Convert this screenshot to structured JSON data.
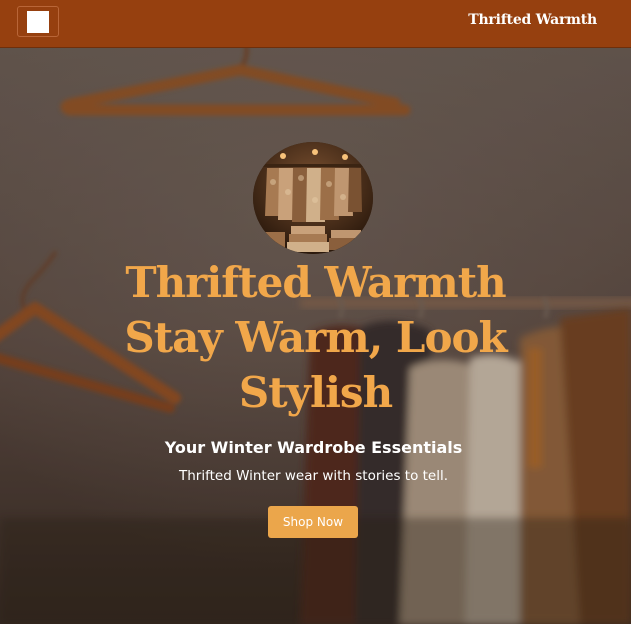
{
  "navbar": {
    "menu_icon": "square-icon",
    "brand": "Thrifted Warmth",
    "background": "#96400f"
  },
  "hero": {
    "title_line1": "Thrifted Warmth",
    "title_line2": "Stay Warm, Look",
    "title_line3": "Stylish",
    "subtitle": "Your Winter Wardrobe Essentials",
    "tagline": "Thrifted Winter wear with stories to tell.",
    "cta_label": "Shop Now",
    "title_color": "#f1a74a",
    "cta_color": "#eba64b"
  }
}
